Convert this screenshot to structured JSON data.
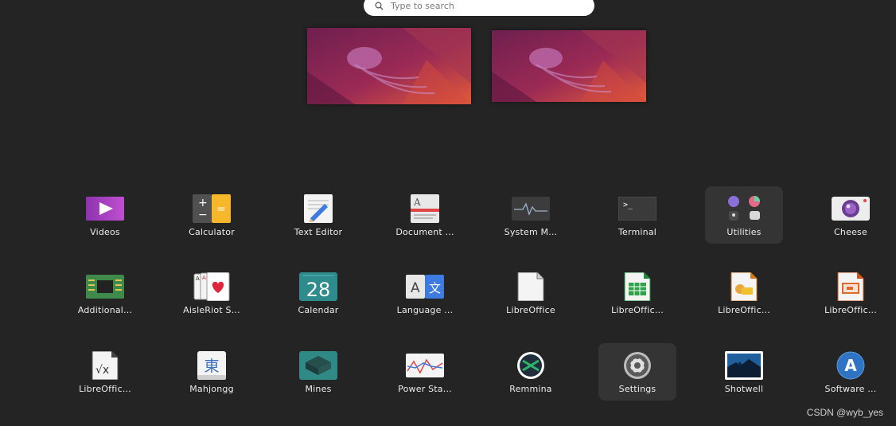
{
  "search": {
    "placeholder": "Type to search"
  },
  "apps": [
    {
      "label": "Videos",
      "icon": "videos-icon"
    },
    {
      "label": "Calculator",
      "icon": "calculator-icon"
    },
    {
      "label": "Text Editor",
      "icon": "text-editor-icon"
    },
    {
      "label": "Document ...",
      "icon": "document-viewer-icon"
    },
    {
      "label": "System M...",
      "icon": "system-monitor-icon"
    },
    {
      "label": "Terminal",
      "icon": "terminal-icon"
    },
    {
      "label": "Utilities",
      "icon": "utilities-folder-icon"
    },
    {
      "label": "Cheese",
      "icon": "cheese-icon"
    },
    {
      "label": "Additional...",
      "icon": "additional-drivers-icon"
    },
    {
      "label": "AisleRiot S...",
      "icon": "aisleriot-icon"
    },
    {
      "label": "Calendar",
      "icon": "calendar-icon"
    },
    {
      "label": "Language ...",
      "icon": "language-support-icon"
    },
    {
      "label": "LibreOffice",
      "icon": "libreoffice-icon"
    },
    {
      "label": "LibreOffic...",
      "icon": "libreoffice-calc-icon"
    },
    {
      "label": "LibreOffic...",
      "icon": "libreoffice-draw-icon"
    },
    {
      "label": "LibreOffic...",
      "icon": "libreoffice-impress-icon"
    },
    {
      "label": "LibreOffic...",
      "icon": "libreoffice-math-icon"
    },
    {
      "label": "Mahjongg",
      "icon": "mahjongg-icon"
    },
    {
      "label": "Mines",
      "icon": "mines-icon"
    },
    {
      "label": "Power Sta...",
      "icon": "power-statistics-icon"
    },
    {
      "label": "Remmina",
      "icon": "remmina-icon"
    },
    {
      "label": "Settings",
      "icon": "settings-icon"
    },
    {
      "label": "Shotwell",
      "icon": "shotwell-icon"
    },
    {
      "label": "Software ...",
      "icon": "software-icon"
    }
  ],
  "calendar_day": "28",
  "watermark": "CSDN @wyb_yes",
  "colors": {
    "background": "#242424",
    "wallpaper_left": "#8a2452",
    "wallpaper_right": "#d9533b"
  }
}
